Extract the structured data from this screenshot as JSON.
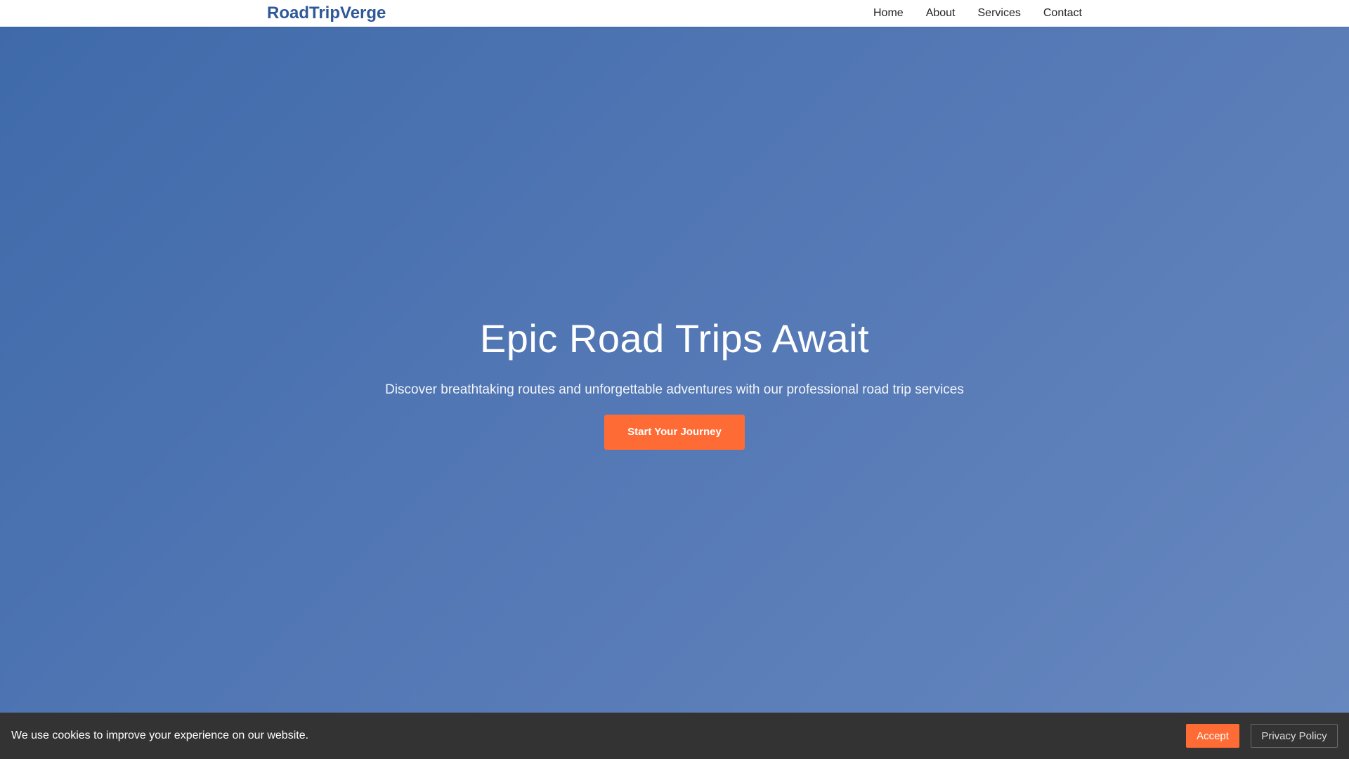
{
  "navbar": {
    "logo": "RoadTripVerge",
    "links": [
      "Home",
      "About",
      "Services",
      "Contact"
    ]
  },
  "hero": {
    "title": "Epic Road Trips Await",
    "subtitle": "Discover breathtaking routes and unforgettable adventures with our professional road trip services",
    "cta_label": "Start Your Journey"
  },
  "cookie": {
    "message": "We use cookies to improve your experience on our website.",
    "accept_label": "Accept",
    "privacy_label": "Privacy Policy"
  },
  "colors": {
    "brand": "#2f5899",
    "accent": "#ff6b35",
    "hero_start": "#3f6aaa",
    "hero_end": "#6787bf",
    "banner_bg": "#333333"
  }
}
